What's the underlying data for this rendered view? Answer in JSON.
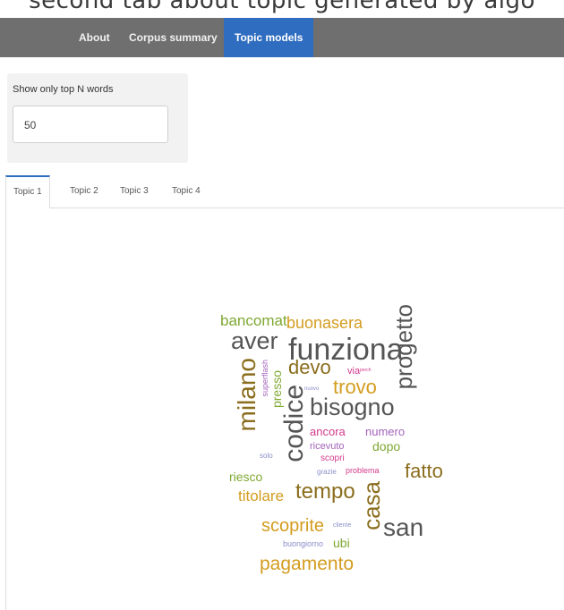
{
  "caption": "second tab about topic generated by algo",
  "nav": {
    "items": [
      "About",
      "Corpus summary",
      "Topic models"
    ],
    "active": 2
  },
  "sidebar": {
    "label": "Show only top N words",
    "input_value": "50"
  },
  "tabs": {
    "items": [
      "Topic 1",
      "Topic 2",
      "Topic 3",
      "Topic 4"
    ],
    "active": 0
  },
  "wordcloud": {
    "words": [
      {
        "t": "bancomat",
        "c": "#7fa832"
      },
      {
        "t": "buonasera",
        "c": "#d39c1f"
      },
      {
        "t": "aver",
        "c": "#555555"
      },
      {
        "t": "funziona",
        "c": "#555555"
      },
      {
        "t": "progetto",
        "c": "#555555"
      },
      {
        "t": "milano",
        "c": "#8a6d1c"
      },
      {
        "t": "superflash",
        "c": "#a463bd"
      },
      {
        "t": "presso",
        "c": "#7fa832"
      },
      {
        "t": "devo",
        "c": "#8a6d1c"
      },
      {
        "t": "via",
        "c": "#d33a8c"
      },
      {
        "t": "perch",
        "c": "#d33a8c"
      },
      {
        "t": "nuovo",
        "c": "#8a8fc9"
      },
      {
        "t": "trovo",
        "c": "#d39c1f"
      },
      {
        "t": "codice",
        "c": "#555555"
      },
      {
        "t": "bisogno",
        "c": "#555555"
      },
      {
        "t": "ancora",
        "c": "#d33a8c"
      },
      {
        "t": "numero",
        "c": "#a463bd"
      },
      {
        "t": "ricevuto",
        "c": "#a463bd"
      },
      {
        "t": "dopo",
        "c": "#7fa832"
      },
      {
        "t": "solo",
        "c": "#8a8fc9"
      },
      {
        "t": "scopri",
        "c": "#d33a8c"
      },
      {
        "t": "riesco",
        "c": "#7fa832"
      },
      {
        "t": "grazie",
        "c": "#8a8fc9"
      },
      {
        "t": "problema",
        "c": "#d33a8c"
      },
      {
        "t": "fatto",
        "c": "#8a6d1c"
      },
      {
        "t": "titolare",
        "c": "#d39c1f"
      },
      {
        "t": "tempo",
        "c": "#8a6d1c"
      },
      {
        "t": "casa",
        "c": "#8a6d1c"
      },
      {
        "t": "scoprite",
        "c": "#d39c1f"
      },
      {
        "t": "cliente",
        "c": "#8a8fc9"
      },
      {
        "t": "san",
        "c": "#555555"
      },
      {
        "t": "buongiorno",
        "c": "#8a8fc9"
      },
      {
        "t": "ubi",
        "c": "#7fa832"
      },
      {
        "t": "pagamento",
        "c": "#d39c1f"
      }
    ]
  }
}
